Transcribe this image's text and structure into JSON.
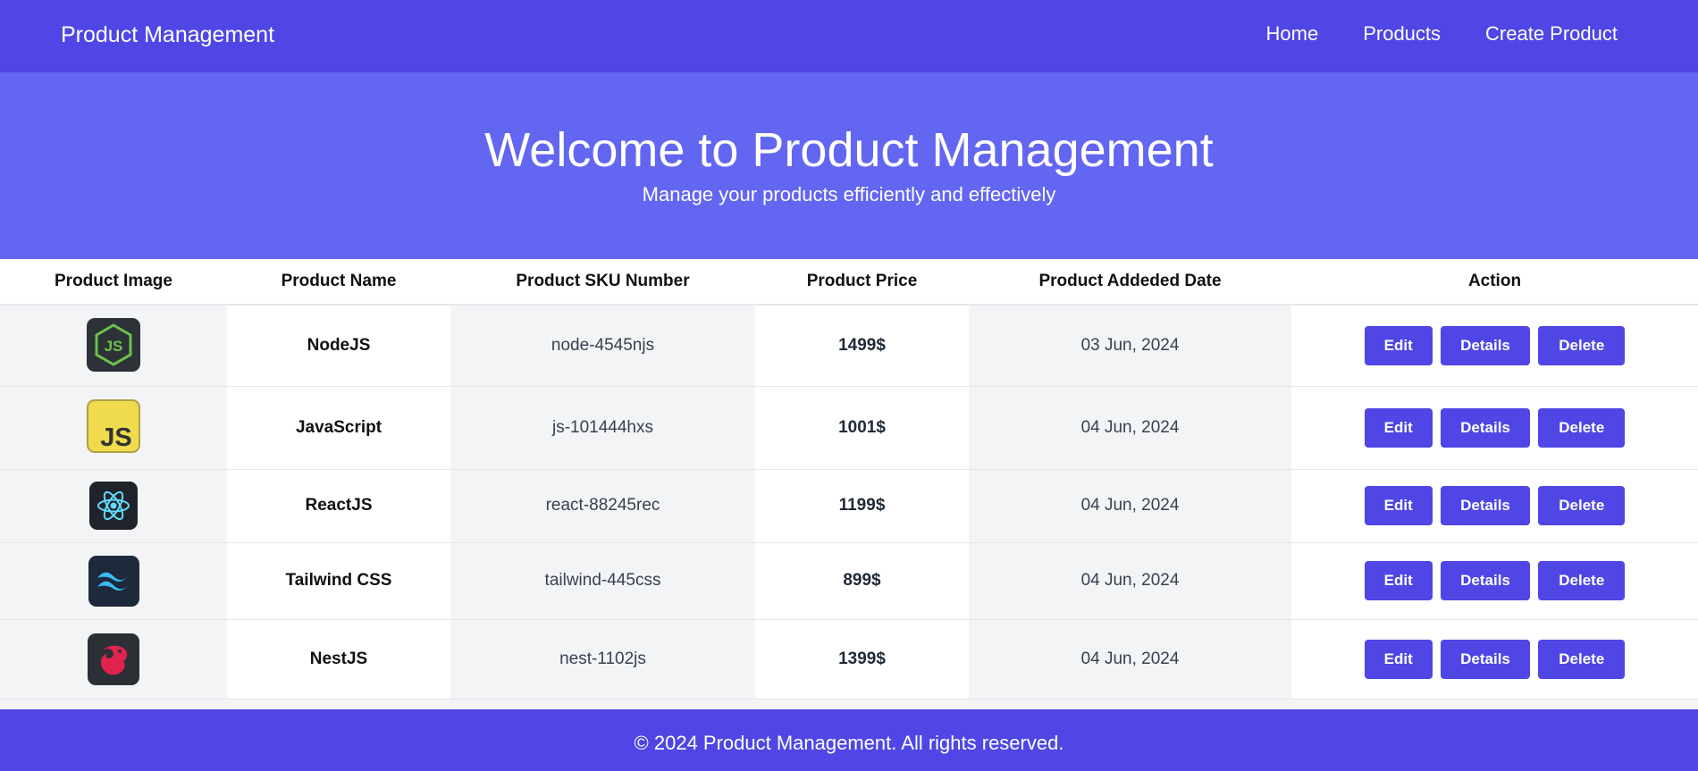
{
  "navbar": {
    "brand": "Product Management",
    "links": [
      "Home",
      "Products",
      "Create Product"
    ]
  },
  "hero": {
    "title": "Welcome to Product Management",
    "subtitle": "Manage your products efficiently and effectively"
  },
  "table": {
    "headers": [
      "Product Image",
      "Product Name",
      "Product SKU Number",
      "Product Price",
      "Product Addeded Date",
      "Action"
    ],
    "rows": [
      {
        "icon": "nodejs-logo-icon",
        "name": "NodeJS",
        "sku": "node-4545njs",
        "price": "1499$",
        "date": "03 Jun, 2024"
      },
      {
        "icon": "javascript-logo-icon",
        "name": "JavaScript",
        "sku": "js-101444hxs",
        "price": "1001$",
        "date": "04 Jun, 2024"
      },
      {
        "icon": "react-logo-icon",
        "name": "ReactJS",
        "sku": "react-88245rec",
        "price": "1199$",
        "date": "04 Jun, 2024"
      },
      {
        "icon": "tailwind-logo-icon",
        "name": "Tailwind CSS",
        "sku": "tailwind-445css",
        "price": "899$",
        "date": "04 Jun, 2024"
      },
      {
        "icon": "nestjs-logo-icon",
        "name": "NestJS",
        "sku": "nest-1102js",
        "price": "1399$",
        "date": "04 Jun, 2024"
      }
    ],
    "actions": {
      "edit": "Edit",
      "details": "Details",
      "delete": "Delete"
    }
  },
  "footer": {
    "text": "© 2024 Product Management. All rights reserved."
  },
  "colors": {
    "navbar": "#4f46e5",
    "hero": "#6366f1",
    "button": "#4f46e5",
    "footer": "#4f46e5"
  }
}
